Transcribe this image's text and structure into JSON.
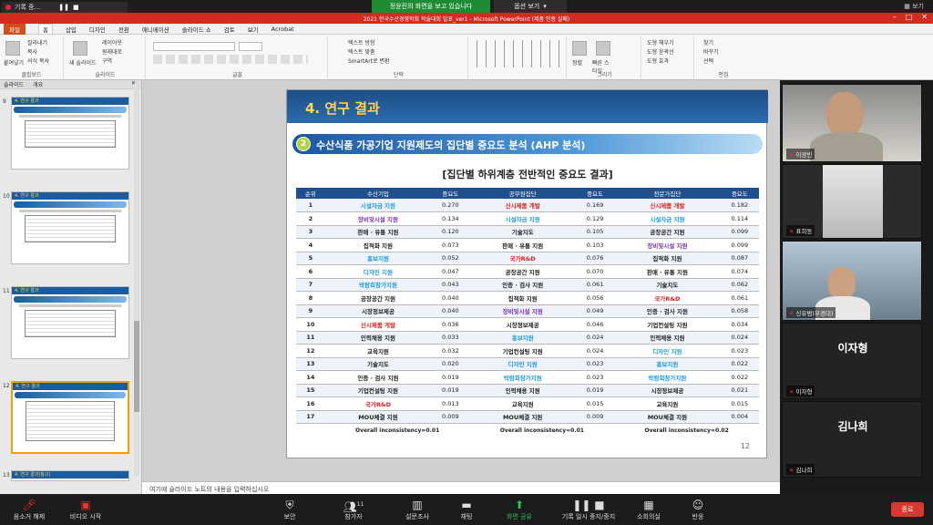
{
  "zoom_top": {
    "recording_label": "기록 중...",
    "share_banner": "정윤진의 화면을 보고 있습니다",
    "view_options": "옵션 보기",
    "right_label": "보기"
  },
  "ppt": {
    "title": "2021 한국수산경영학회 학술대회 발표_ver1 - Microsoft PowerPoint (제품 인증 실패)",
    "tabs": [
      "파일",
      "홈",
      "삽입",
      "디자인",
      "전환",
      "애니메이션",
      "슬라이드 쇼",
      "검토",
      "보기",
      "Acrobat"
    ],
    "ribbon": {
      "clipboard": {
        "label": "클립보드",
        "paste": "붙여넣기",
        "cut": "잘라내기",
        "copy": "복사",
        "format_painter": "서식 복사"
      },
      "slides": {
        "label": "슬라이드",
        "new_slide": "새 슬라이드",
        "layout": "레이아웃",
        "reset": "원래대로",
        "section": "구역"
      },
      "font": {
        "label": "글꼴"
      },
      "paragraph": {
        "label": "단락",
        "text_direction": "텍스트 방향",
        "align_text": "텍스트 맞춤",
        "smartart": "SmartArt로 변환"
      },
      "drawing": {
        "label": "그리기",
        "arrange": "정렬",
        "quick_styles": "빠른 스타일",
        "shape_fill": "도형 채우기",
        "shape_outline": "도형 윤곽선",
        "shape_effects": "도형 효과"
      },
      "editing": {
        "label": "편집",
        "find": "찾기",
        "replace": "바꾸기",
        "select": "선택"
      }
    },
    "pane_tabs": [
      "슬라이드",
      "개요"
    ],
    "notes_placeholder": "여기에 슬라이드 노트의 내용을 입력하십시오"
  },
  "thumbnails": [
    {
      "num": "9",
      "title": "4. 연구 결과"
    },
    {
      "num": "10",
      "title": "4. 연구 결과"
    },
    {
      "num": "11",
      "title": "4. 연구 결과"
    },
    {
      "num": "12",
      "title": "4. 연구 결과"
    },
    {
      "num": "13",
      "title": "4. 연구 결과(참고)"
    }
  ],
  "slide": {
    "title": "4. 연구 결과",
    "sub_number": "2",
    "sub_title": "수산식품 가공기업 지원제도의 집단별 중요도 분석 (AHP 분석)",
    "table_title": "[집단별 하위계층 전반적인 중요도 결과]",
    "page_number": "12",
    "headers": [
      "순위",
      "수산기업",
      "중요도",
      "공무원집단",
      "중요도",
      "전문가집단",
      "중요도"
    ],
    "rows": [
      {
        "rank": "1",
        "a": "시설자금 지원",
        "ac": "blue",
        "av": "0.270",
        "b": "신시제품 개발",
        "bc": "red",
        "bv": "0.169",
        "c": "신시제품 개발",
        "cc": "red",
        "cv": "0.182"
      },
      {
        "rank": "2",
        "a": "장비및시설 지원",
        "ac": "purple",
        "av": "0.134",
        "b": "시설자금 지원",
        "bc": "blue",
        "bv": "0.129",
        "c": "시설자금 지원",
        "cc": "blue",
        "cv": "0.114"
      },
      {
        "rank": "3",
        "a": "판매 · 유통 지원",
        "ac": "",
        "av": "0.120",
        "b": "기술지도",
        "bc": "",
        "bv": "0.105",
        "c": "공장공간 지원",
        "cc": "",
        "cv": "0.099"
      },
      {
        "rank": "4",
        "a": "집적화 지원",
        "ac": "",
        "av": "0.073",
        "b": "판매 · 유통 지원",
        "bc": "",
        "bv": "0.103",
        "c": "장비및시설 지원",
        "cc": "purple",
        "cv": "0.099"
      },
      {
        "rank": "5",
        "a": "홍보지원",
        "ac": "blue",
        "av": "0.052",
        "b": "국가R&D",
        "bc": "red",
        "bv": "0.076",
        "c": "집적화 지원",
        "cc": "",
        "cv": "0.087"
      },
      {
        "rank": "6",
        "a": "디자인 지원",
        "ac": "blue",
        "av": "0.047",
        "b": "공장공간 지원",
        "bc": "",
        "bv": "0.070",
        "c": "판매 · 유통 지원",
        "cc": "",
        "cv": "0.074"
      },
      {
        "rank": "7",
        "a": "박람회참가지원",
        "ac": "blue",
        "av": "0.043",
        "b": "인증 · 검사 지원",
        "bc": "",
        "bv": "0.061",
        "c": "기술지도",
        "cc": "",
        "cv": "0.062"
      },
      {
        "rank": "8",
        "a": "공장공간 지원",
        "ac": "",
        "av": "0.040",
        "b": "집적화 지원",
        "bc": "",
        "bv": "0.056",
        "c": "국가R&D",
        "cc": "red",
        "cv": "0.061"
      },
      {
        "rank": "9",
        "a": "시장정보제공",
        "ac": "",
        "av": "0.040",
        "b": "장비및시설 지원",
        "bc": "purple",
        "bv": "0.049",
        "c": "인증 · 검사 지원",
        "cc": "",
        "cv": "0.058"
      },
      {
        "rank": "10",
        "a": "신시제품 개발",
        "ac": "red",
        "av": "0.036",
        "b": "시장정보제공",
        "bc": "",
        "bv": "0.046",
        "c": "기업컨설팅 지원",
        "cc": "",
        "cv": "0.034"
      },
      {
        "rank": "11",
        "a": "인력채용 지원",
        "ac": "",
        "av": "0.033",
        "b": "홍보지원",
        "bc": "blue",
        "bv": "0.024",
        "c": "인력채용 지원",
        "cc": "",
        "cv": "0.024"
      },
      {
        "rank": "12",
        "a": "교육지원",
        "ac": "",
        "av": "0.032",
        "b": "기업컨설팅 지원",
        "bc": "",
        "bv": "0.024",
        "c": "디자인 지원",
        "cc": "blue",
        "cv": "0.023"
      },
      {
        "rank": "13",
        "a": "기술지도",
        "ac": "",
        "av": "0.020",
        "b": "디자인 지원",
        "bc": "blue",
        "bv": "0.023",
        "c": "홍보지원",
        "cc": "blue",
        "cv": "0.022"
      },
      {
        "rank": "14",
        "a": "인증 · 검사 지원",
        "ac": "",
        "av": "0.019",
        "b": "박람회참가지원",
        "bc": "blue",
        "bv": "0.023",
        "c": "박람회참가지원",
        "cc": "blue",
        "cv": "0.022"
      },
      {
        "rank": "15",
        "a": "기업컨설팅 지원",
        "ac": "",
        "av": "0.019",
        "b": "인력채용 지원",
        "bc": "",
        "bv": "0.019",
        "c": "시장정보제공",
        "cc": "",
        "cv": "0.021"
      },
      {
        "rank": "16",
        "a": "국가R&D",
        "ac": "red",
        "av": "0.013",
        "b": "교육지원",
        "bc": "",
        "bv": "0.015",
        "c": "교육지원",
        "cc": "",
        "cv": "0.015"
      },
      {
        "rank": "17",
        "a": "MOU체결 지원",
        "ac": "",
        "av": "0.009",
        "b": "MOU체결 지원",
        "bc": "",
        "bv": "0.009",
        "c": "MOU체결 지원",
        "cc": "",
        "cv": "0.004"
      }
    ],
    "overall": [
      "Overall inconsistency=0.01",
      "Overall inconsistency=0.01",
      "Overall inconsistency=0.02"
    ]
  },
  "participants": [
    {
      "name": "이광빈",
      "type": "video"
    },
    {
      "name": "표희동",
      "type": "video"
    },
    {
      "name": "신유범(부경대)",
      "type": "video"
    },
    {
      "name": "이자형",
      "type": "name"
    },
    {
      "name": "김나희",
      "type": "name"
    }
  ],
  "zoom_bar": {
    "mute": "음소거 해제",
    "video": "비디오 시작",
    "security": "보안",
    "participants": "참가자",
    "participant_count": "11",
    "poll": "설문조사",
    "chat": "채팅",
    "share": "화면 공유",
    "record": "기록 일시 중지/중지",
    "breakout": "소회의실",
    "reactions": "반응",
    "end": "종료"
  },
  "colors": {
    "red": "#e02020",
    "blue": "#1e9be0",
    "purple": "#7a2fb8",
    "header": "#1f4f8f",
    "share_green": "#1f8b33"
  }
}
